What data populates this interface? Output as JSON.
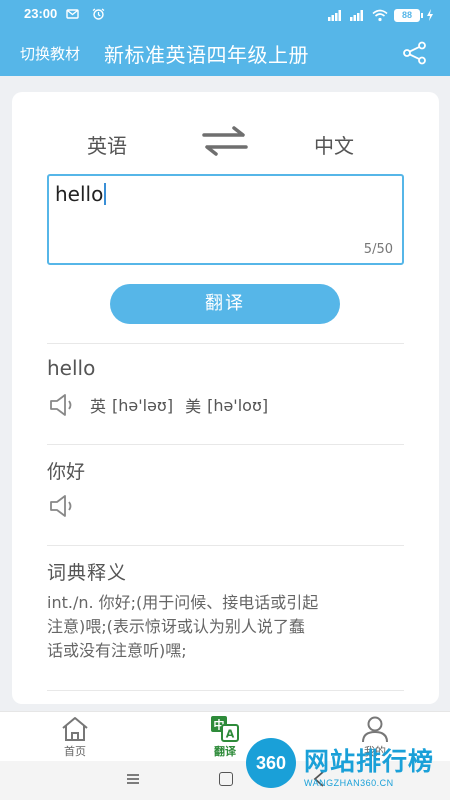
{
  "status_bar": {
    "time": "23:00",
    "battery": "88"
  },
  "header": {
    "switch_book_label": "切换教材",
    "title": "新标准英语四年级上册"
  },
  "translator": {
    "source_lang": "英语",
    "target_lang": "中文",
    "input_value": "hello",
    "char_count": "5/50",
    "translate_button": "翻译"
  },
  "result": {
    "word": "hello",
    "uk_label": "英",
    "uk_phonetic": "[hə'ləʊ]",
    "us_label": "美",
    "us_phonetic": "[hə'loʊ]",
    "translation": "你好",
    "dict_title": "词典释义",
    "dict_line1": "int./n. 你好;(用于问候、接电话或引起",
    "dict_line2": "注意)喂;(表示惊讶或认为别人说了蠢",
    "dict_line3": "话或没有注意听)嘿;"
  },
  "tabs": [
    {
      "label": "首页",
      "icon": "home-icon"
    },
    {
      "label": "翻译",
      "icon": "translate-icon"
    },
    {
      "label": "我的",
      "icon": "user-icon"
    }
  ],
  "watermark": {
    "badge": "360",
    "text": "网站排行榜",
    "url": "WANGZHAN360.CN"
  },
  "colors": {
    "accent": "#56b6e8",
    "active_tab": "#2e8b3a",
    "watermark": "#1aa0d8"
  }
}
